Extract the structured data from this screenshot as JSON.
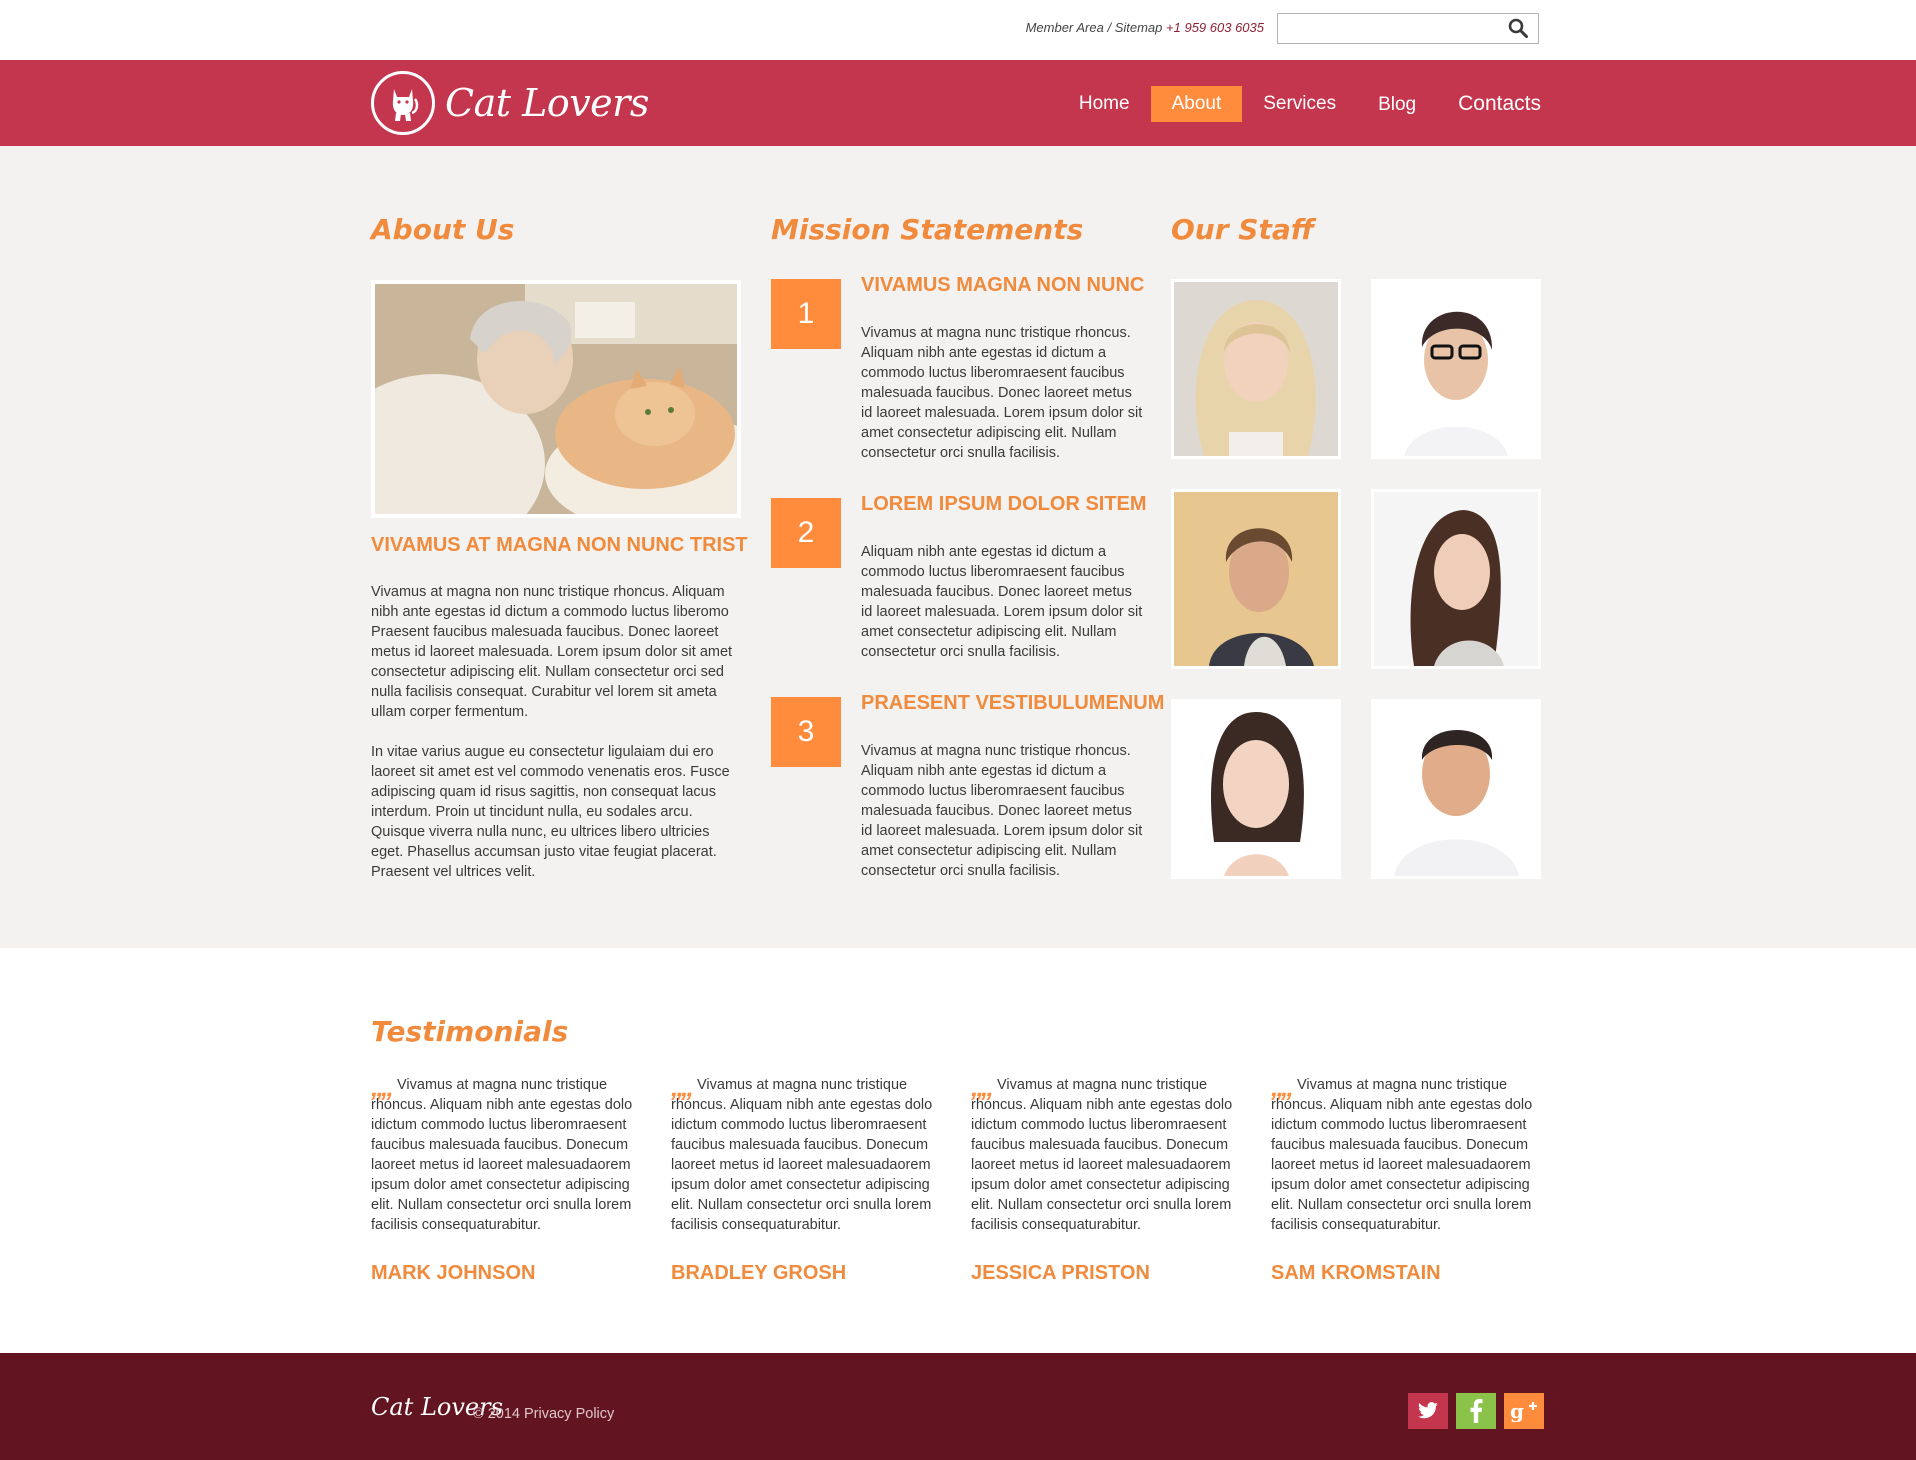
{
  "topbar": {
    "member_area": "Member Area",
    "separator": " / ",
    "sitemap": "Sitemap",
    "phone": "+1 959 603 6035",
    "search_placeholder": ""
  },
  "header": {
    "brand": "Cat Lovers",
    "nav": [
      {
        "label": "Home",
        "active": false
      },
      {
        "label": "About",
        "active": true
      },
      {
        "label": "Services",
        "active": false
      },
      {
        "label": "Blog",
        "active": false
      },
      {
        "label": "Contacts",
        "active": false
      }
    ]
  },
  "about": {
    "heading": "About Us",
    "subheading": "VIVAMUS AT MAGNA NON NUNC TRIST",
    "paragraph1": "Vivamus at magna non nunc tristique rhoncus. Aliquam nibh ante egestas id dictum a commodo luctus liberomo Praesent faucibus malesuada faucibus. Donec laoreet metus id laoreet malesuada. Lorem ipsum dolor sit amet consectetur adipiscing elit. Nullam consectetur orci sed nulla facilisis consequat. Curabitur vel lorem sit ameta ullam corper fermentum.",
    "paragraph2": "In vitae varius augue eu consectetur ligulaiam dui ero laoreet sit amet est vel commodo venenatis eros. Fusce adipiscing quam id risus sagittis, non consequat lacus interdum. Proin ut tincidunt nulla, eu sodales arcu. Quisque viverra nulla nunc, eu ultrices libero ultricies eget. Phasellus accumsan justo vitae feugiat placerat. Praesent vel ultrices velit."
  },
  "mission": {
    "heading": "Mission Statements",
    "items": [
      {
        "number": "1",
        "title": "VIVAMUS MAGNA NON NUNC",
        "text": "Vivamus at magna nunc tristique rhoncus. Aliquam nibh ante egestas id dictum a commodo luctus liberomraesent faucibus malesuada faucibus. Donec laoreet metus id laoreet malesuada. Lorem ipsum dolor sit amet consectetur adipiscing elit. Nullam consectetur orci snulla facilisis."
      },
      {
        "number": "2",
        "title": "LOREM IPSUM DOLOR SITEM",
        "text": "Aliquam nibh ante egestas id dictum a commodo luctus liberomraesent faucibus malesuada faucibus. Donec laoreet metus id laoreet malesuada. Lorem ipsum dolor sit amet consectetur adipiscing elit. Nullam consectetur orci snulla facilisis."
      },
      {
        "number": "3",
        "title": "PRAESENT VESTIBULUMENUM",
        "text": "Vivamus at magna nunc tristique rhoncus. Aliquam nibh ante egestas id dictum a commodo luctus liberomraesent faucibus malesuada faucibus. Donec laoreet metus id laoreet malesuada. Lorem ipsum dolor sit amet consectetur adipiscing elit. Nullam consectetur orci snulla facilisis."
      }
    ]
  },
  "staff": {
    "heading": "Our Staff"
  },
  "testimonials": {
    "heading": "Testimonials",
    "quote_mark": "„„",
    "items": [
      {
        "text": "Vivamus at magna nunc tristique rhoncus. Aliquam nibh ante egestas dolo idictum commodo luctus liberomraesent faucibus malesuada faucibus. Donecum laoreet metus id laoreet malesuadaorem ipsum dolor amet consectetur adipiscing elit. Nullam consectetur orci snulla lorem facilisis consequaturabitur.",
        "name": "MARK JOHNSON"
      },
      {
        "text": "Vivamus at magna nunc tristique rhoncus. Aliquam nibh ante egestas dolo idictum commodo luctus liberomraesent faucibus malesuada faucibus. Donecum laoreet metus id laoreet malesuadaorem ipsum dolor amet consectetur adipiscing elit. Nullam consectetur orci snulla lorem facilisis consequaturabitur.",
        "name": "BRADLEY GROSH"
      },
      {
        "text": "Vivamus at magna nunc tristique rhoncus. Aliquam nibh ante egestas dolo idictum commodo luctus liberomraesent faucibus malesuada faucibus. Donecum laoreet metus id laoreet malesuadaorem ipsum dolor amet consectetur adipiscing elit. Nullam consectetur orci snulla lorem facilisis consequaturabitur.",
        "name": "JESSICA PRISTON"
      },
      {
        "text": "Vivamus at magna nunc tristique rhoncus. Aliquam nibh ante egestas dolo idictum commodo luctus liberomraesent faucibus malesuada faucibus. Donecum laoreet metus id laoreet malesuadaorem ipsum dolor amet consectetur adipiscing elit. Nullam consectetur orci snulla lorem facilisis consequaturabitur.",
        "name": "SAM KROMSTAIN"
      }
    ]
  },
  "footer": {
    "brand": "Cat Lovers",
    "copyright": "© 2014",
    "privacy": "Privacy Policy",
    "social": [
      {
        "icon": "twitter-icon",
        "color": "#c4364e"
      },
      {
        "icon": "facebook-icon",
        "color": "#8bc34a"
      },
      {
        "icon": "google-plus-icon",
        "color": "#ff8b3d"
      }
    ]
  },
  "colors": {
    "brand_red": "#c4364e",
    "accent_orange": "#ff8b3d",
    "heading_orange": "#f08a3c",
    "footer_maroon": "#621420",
    "content_bg": "#f3f2f0"
  }
}
